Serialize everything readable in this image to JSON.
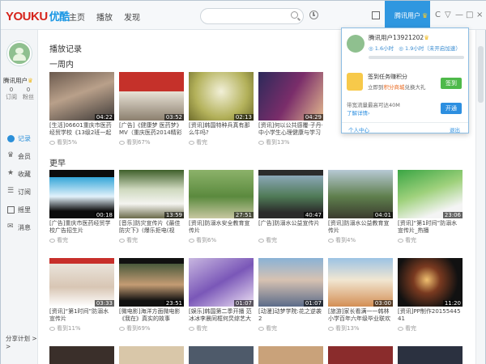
{
  "header": {
    "logo_youku": "YOUKU",
    "logo_cn": "优酷",
    "nav": [
      "主页",
      "播放",
      "发现"
    ],
    "search_placeholder": "",
    "user_tab_label": "腾讯用户",
    "window_controls": [
      "C",
      "▽",
      "—",
      "□",
      "×"
    ]
  },
  "sidebar": {
    "username": "腾讯用户",
    "stats": [
      {
        "value": "0",
        "label": "订阅"
      },
      {
        "value": "0",
        "label": "粉丝"
      }
    ],
    "menu": [
      {
        "label": "记录",
        "icon": "history-icon"
      },
      {
        "label": "会员",
        "icon": "crown-icon"
      },
      {
        "label": "收藏",
        "icon": "star-icon"
      },
      {
        "label": "订阅",
        "icon": "subscribe-icon"
      },
      {
        "label": "摇里",
        "icon": "box-icon"
      },
      {
        "label": "消息",
        "icon": "mail-icon"
      }
    ],
    "share_plan": "分享计划 > >"
  },
  "main": {
    "page_title": "播放记录",
    "section_week": "一周内",
    "section_earlier": "更早",
    "week_videos": [
      {
        "duration": "04:22",
        "title": "[生活]06601重庆市医药经贸学校《13级2班一起走过...",
        "views": "看到5%"
      },
      {
        "duration": "03:52",
        "title": "[广告]《健康梦 医药梦》MV（重庆医药2014精彩再现）",
        "views": "看到67%"
      },
      {
        "duration": "02:13",
        "title": "[资讯]韩国特种兵真有那么牛吗?",
        "views": "看完"
      },
      {
        "duration": "04:29",
        "title": "[资讯]何以公共感覆·子丹·中小学生心理健康与学习习惯...",
        "views": "看到13%"
      }
    ],
    "earlier_videos": [
      {
        "duration": "00:18",
        "title": "[广告]重庆市医药经贸学校广告招生片",
        "views": "看完"
      },
      {
        "duration": "13:59",
        "title": "[音乐]防灾宣传片《最佳防灾下》(爆乐拒电(视频)) ...",
        "views": "看完"
      },
      {
        "duration": "27:51",
        "title": "[资讯]防溺水安全教育宣传片",
        "views": "看到6%"
      },
      {
        "duration": "40:47",
        "title": "[广告]防溺水公益宣传片",
        "views": "看完"
      },
      {
        "duration": "04:01",
        "title": "[资讯]防溺水公益教育宣传片",
        "views": "看到4%"
      },
      {
        "duration": "23:06",
        "title": "[资讯]“第1时间”防溺水宣传片_热播",
        "views": "看完"
      },
      {
        "duration": "03:33",
        "title": "[资讯]“第1时间”防溺水宣传片",
        "views": "看到11%"
      },
      {
        "duration": "23:51",
        "title": "[微电影]海洋方面微电影《我在》真实的故事",
        "views": "看到69%"
      },
      {
        "duration": "01:07",
        "title": "[娱乐]韩国第二季开播 范冰冰李晨同框何炅综艺大咖",
        "views": "看完"
      },
      {
        "duration": "01:07",
        "title": "[动漫]动梦学院:花之逆袭2",
        "views": "看完"
      },
      {
        "duration": "03:00",
        "title": "[旅游]家长看满一一韩林小学百年六年级毕业联欢会",
        "views": "看到13%"
      },
      {
        "duration": "11:20",
        "title": "[资讯]PP制作20155445 41",
        "views": "看完"
      }
    ]
  },
  "popup": {
    "username": "腾讯用户13921202",
    "level_label": "1.6小时",
    "level_label_2": "1.9小时（未开启加速）",
    "sign_title": "签到任务赚积分",
    "sign_desc_prefix": "立即到",
    "sign_desc_link": "积分商城",
    "sign_desc_suffix": "兑换大礼",
    "sign_button": "签到",
    "store_text": "带宽流量最高可达40M",
    "store_link": "了解详情›",
    "open_button": "开通",
    "personal_center": "个人中心",
    "logout": "退出"
  },
  "colors": {
    "accent": "#2f97e0",
    "logo_red": "#d6241c",
    "green": "#4eb94a",
    "orange": "#e9681e"
  }
}
